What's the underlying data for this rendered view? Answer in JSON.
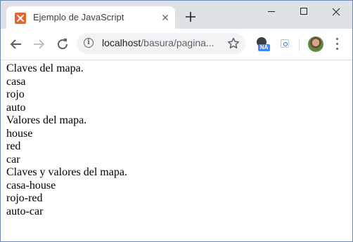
{
  "browser": {
    "tab": {
      "title": "Ejemplo de JavaScript",
      "favicon": "xampp-icon"
    },
    "address": {
      "host": "localhost",
      "path": "/basura/pagina..."
    },
    "extension_badge": "NA"
  },
  "page": {
    "lines": [
      "Claves del mapa.",
      "casa",
      "rojo",
      "auto",
      "Valores del mapa.",
      "house",
      "red",
      "car",
      "Claves y valores del mapa.",
      "casa-house",
      "rojo-red",
      "auto-car"
    ]
  },
  "colors": {
    "tabstrip": "#dee1e6",
    "favicon": "#e96228",
    "omnibox": "#f1f3f4",
    "badge": "#4285f4"
  }
}
